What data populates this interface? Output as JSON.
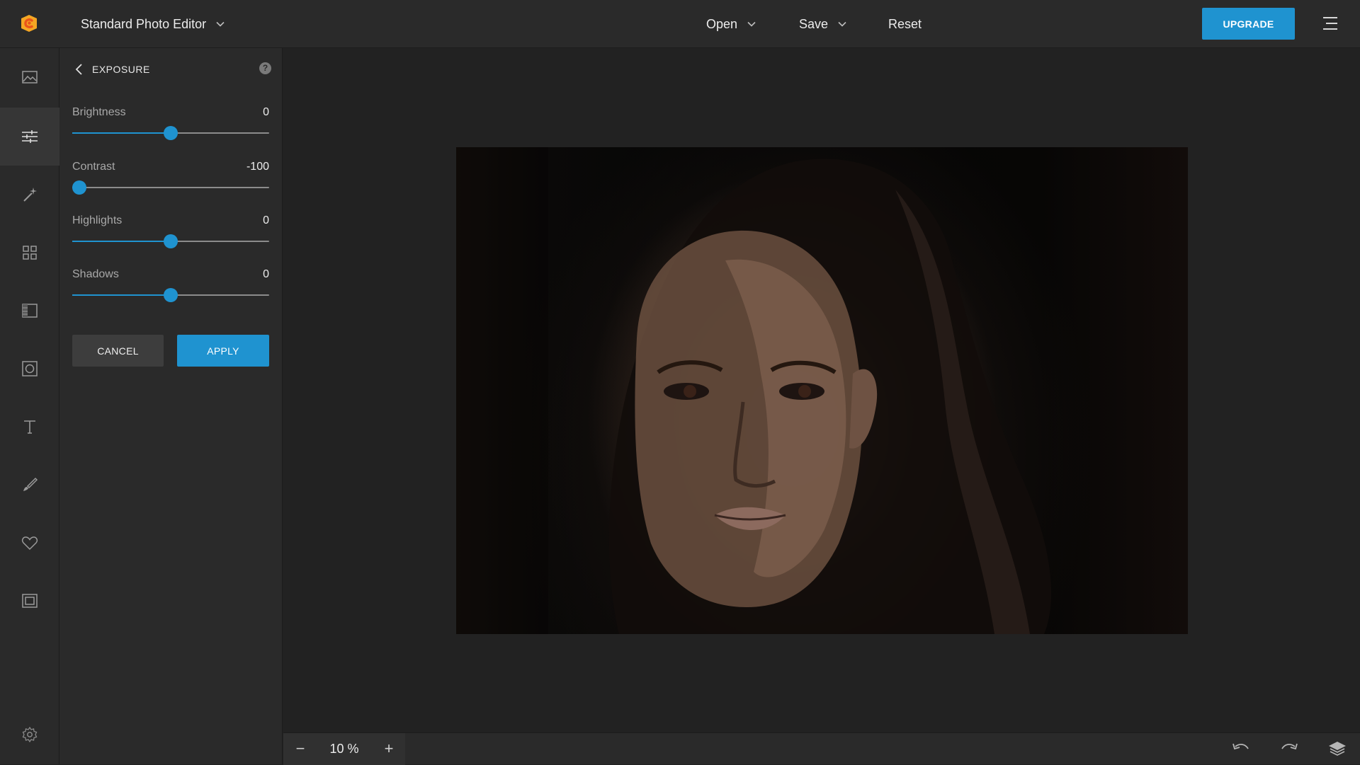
{
  "app": {
    "title": "Standard Photo Editor",
    "accent": "#1f93d0"
  },
  "top_menu": {
    "open_label": "Open",
    "save_label": "Save",
    "reset_label": "Reset",
    "upgrade_label": "UPGRADE"
  },
  "rail": {
    "icons": [
      "image-icon",
      "adjust-sliders-icon",
      "magic-wand-icon",
      "grid-icon",
      "film-icon",
      "photo-frame-icon",
      "text-icon",
      "brush-icon",
      "heart-icon",
      "frame-icon",
      "settings-icon"
    ],
    "active": "adjust-sliders-icon"
  },
  "panel": {
    "title": "EXPOSURE",
    "help": "?",
    "sliders": [
      {
        "label": "Brightness",
        "value": "0",
        "fraction": 0.5
      },
      {
        "label": "Contrast",
        "value": "-100",
        "fraction": 0.0
      },
      {
        "label": "Highlights",
        "value": "0",
        "fraction": 0.5
      },
      {
        "label": "Shadows",
        "value": "0",
        "fraction": 0.5
      }
    ],
    "cancel_label": "CANCEL",
    "apply_label": "APPLY"
  },
  "bottom_bar": {
    "zoom_minus": "−",
    "zoom_value": "10 %",
    "zoom_plus": "+"
  }
}
